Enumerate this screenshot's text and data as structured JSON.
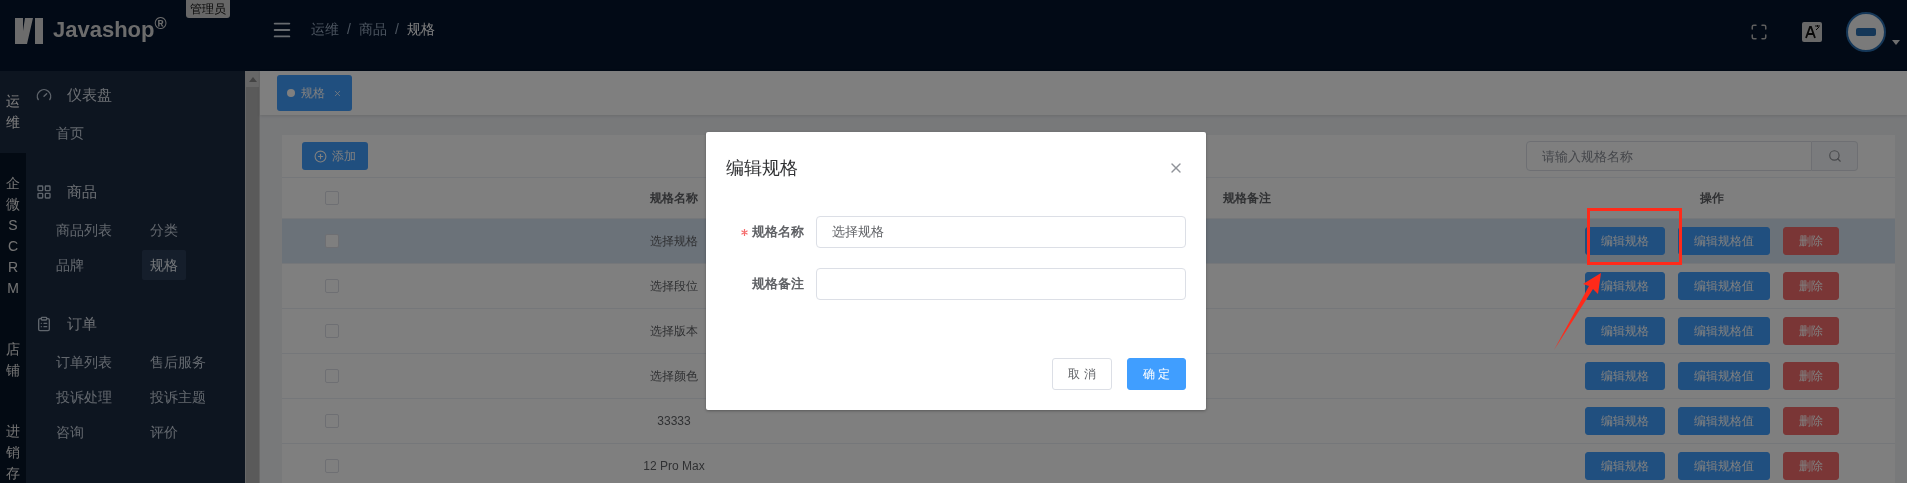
{
  "header": {
    "logo": "Javashop$^{®}$",
    "role_badge": "管理员",
    "breadcrumb": [
      "运维",
      "商品",
      "规格"
    ],
    "breadcrumb_separator": "/"
  },
  "sidebar": {
    "modules": [
      {
        "label": "运维",
        "selected": true
      },
      {
        "label": "企微SCRM",
        "selected": false
      },
      {
        "label": "店铺",
        "selected": false
      },
      {
        "label": "进销存",
        "selected": false
      }
    ],
    "groups": [
      {
        "title": "仪表盘",
        "items": [
          {
            "label": "首页",
            "selected": false
          }
        ]
      },
      {
        "title": "商品",
        "items": [
          {
            "label": "商品列表",
            "selected": false
          },
          {
            "label": "分类",
            "selected": false
          },
          {
            "label": "品牌",
            "selected": false
          },
          {
            "label": "规格",
            "selected": true
          }
        ]
      },
      {
        "title": "订单",
        "items": [
          {
            "label": "订单列表",
            "selected": false
          },
          {
            "label": "售后服务",
            "selected": false
          },
          {
            "label": "投诉处理",
            "selected": false
          },
          {
            "label": "投诉主题",
            "selected": false
          },
          {
            "label": "咨询",
            "selected": false
          },
          {
            "label": "评价",
            "selected": false
          }
        ]
      }
    ]
  },
  "tabs": [
    {
      "label": "规格",
      "selected": true
    }
  ],
  "toolbar": {
    "add_button": "添加",
    "search": {
      "placeholder": "请输入规格名称"
    }
  },
  "table": {
    "all_checked": false,
    "columns": [
      "规格名称",
      "规格备注",
      "操作"
    ],
    "rows": [
      {
        "name": "选择规格",
        "checked": false,
        "selected": true,
        "actions": [
          {
            "label": "编辑规格",
            "kind": "primary"
          },
          {
            "label": "编辑规格值",
            "kind": "primary"
          },
          {
            "label": "删除",
            "kind": "danger"
          }
        ]
      },
      {
        "name": "选择段位",
        "checked": false,
        "selected": false,
        "actions": [
          {
            "label": "编辑规格",
            "kind": "primary"
          },
          {
            "label": "编辑规格值",
            "kind": "primary"
          },
          {
            "label": "删除",
            "kind": "danger"
          }
        ]
      },
      {
        "name": "选择版本",
        "checked": false,
        "selected": false,
        "actions": [
          {
            "label": "编辑规格",
            "kind": "primary"
          },
          {
            "label": "编辑规格值",
            "kind": "primary"
          },
          {
            "label": "删除",
            "kind": "danger"
          }
        ]
      },
      {
        "name": "选择颜色",
        "checked": false,
        "selected": false,
        "actions": [
          {
            "label": "编辑规格",
            "kind": "primary"
          },
          {
            "label": "编辑规格值",
            "kind": "primary"
          },
          {
            "label": "删除",
            "kind": "danger"
          }
        ]
      },
      {
        "name": "33333",
        "checked": false,
        "selected": false,
        "actions": [
          {
            "label": "编辑规格",
            "kind": "primary"
          },
          {
            "label": "编辑规格值",
            "kind": "primary"
          },
          {
            "label": "删除",
            "kind": "danger"
          }
        ]
      },
      {
        "name": "12 Pro Max",
        "checked": false,
        "selected": false,
        "actions": [
          {
            "label": "编辑规格",
            "kind": "primary"
          },
          {
            "label": "编辑规格值",
            "kind": "primary"
          },
          {
            "label": "删除",
            "kind": "danger"
          }
        ]
      }
    ]
  },
  "dialog": {
    "title": "编辑规格",
    "fields": [
      {
        "label": "规格名称",
        "required": true,
        "value": "选择规格"
      },
      {
        "label": "规格备注",
        "required": false
      }
    ],
    "buttons": [
      {
        "label": "取 消",
        "kind": "default"
      },
      {
        "label": "确 定",
        "kind": "primary"
      }
    ]
  }
}
